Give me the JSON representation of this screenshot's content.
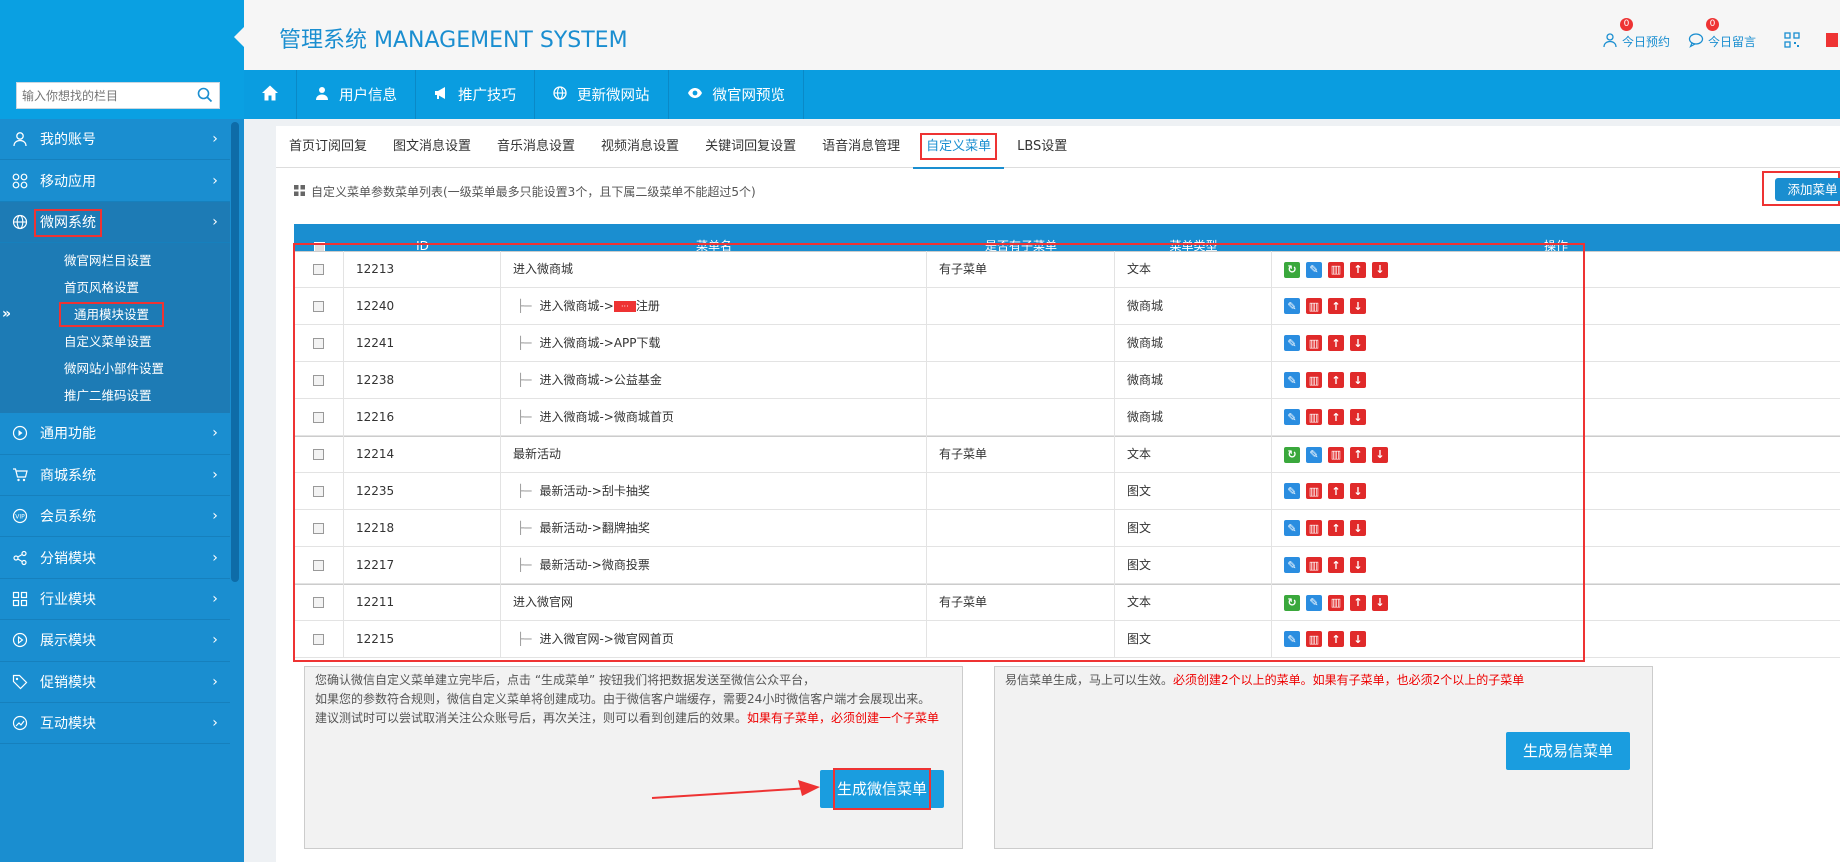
{
  "header": {
    "title": "管理系统 MANAGEMENT SYSTEM",
    "links": [
      {
        "label": "今日预约",
        "badge": "0",
        "icon": "user-icon"
      },
      {
        "label": "今日留言",
        "badge": "0",
        "icon": "chat-icon"
      }
    ]
  },
  "search": {
    "placeholder": "输入你想找的栏目"
  },
  "sidebar": {
    "items": [
      {
        "label": "我的账号",
        "icon": "user-icon"
      },
      {
        "label": "移动应用",
        "icon": "apps-icon"
      },
      {
        "label": "微网系统",
        "icon": "globe-icon",
        "active": true
      },
      {
        "label": "通用功能",
        "icon": "play-icon"
      },
      {
        "label": "商城系统",
        "icon": "cart-icon"
      },
      {
        "label": "会员系统",
        "icon": "vip-icon"
      },
      {
        "label": "分销模块",
        "icon": "share-icon"
      },
      {
        "label": "行业模块",
        "icon": "grid-icon"
      },
      {
        "label": "展示模块",
        "icon": "display-icon"
      },
      {
        "label": "促销模块",
        "icon": "tag-icon"
      },
      {
        "label": "互动模块",
        "icon": "chart-icon"
      }
    ],
    "submenu": [
      "微官网栏目设置",
      "首页风格设置",
      "通用模块设置",
      "自定义菜单设置",
      "微网站小部件设置",
      "推广二维码设置"
    ]
  },
  "navbar": {
    "items": [
      {
        "label": "用户信息",
        "icon": "user-icon"
      },
      {
        "label": "推广技巧",
        "icon": "megaphone-icon"
      },
      {
        "label": "更新微网站",
        "icon": "globe-icon"
      },
      {
        "label": "微官网预览",
        "icon": "eye-icon"
      }
    ]
  },
  "tabs": [
    "首页订阅回复",
    "图文消息设置",
    "音乐消息设置",
    "视频消息设置",
    "关键词回复设置",
    "语音消息管理",
    "自定义菜单",
    "LBS设置"
  ],
  "hint": "自定义菜单参数菜单列表(一级菜单最多只能设置3个，且下属二级菜单不能超过5个)",
  "add_button": "添加菜单",
  "table": {
    "headers": [
      "ID",
      "菜单名",
      "是否有子菜单",
      "菜单类型",
      "操作"
    ],
    "rows": [
      {
        "id": "12213",
        "name": "进入微商城",
        "child": false,
        "has_sub": "有子菜单",
        "type": "文本"
      },
      {
        "id": "12240",
        "name_prefix": "进入微商城->",
        "name": "注册",
        "redacted": true,
        "child": true,
        "has_sub": "",
        "type": "微商城"
      },
      {
        "id": "12241",
        "name": "进入微商城->APP下载",
        "child": true,
        "has_sub": "",
        "type": "微商城"
      },
      {
        "id": "12238",
        "name": "进入微商城->公益基金",
        "child": true,
        "has_sub": "",
        "type": "微商城"
      },
      {
        "id": "12216",
        "name": "进入微商城->微商城首页",
        "child": true,
        "has_sub": "",
        "type": "微商城"
      },
      {
        "id": "12214",
        "name": "最新活动",
        "child": false,
        "has_sub": "有子菜单",
        "type": "文本"
      },
      {
        "id": "12235",
        "name": "最新活动->刮卡抽奖",
        "child": true,
        "has_sub": "",
        "type": "图文"
      },
      {
        "id": "12218",
        "name": "最新活动->翻牌抽奖",
        "child": true,
        "has_sub": "",
        "type": "图文"
      },
      {
        "id": "12217",
        "name": "最新活动->微商投票",
        "child": true,
        "has_sub": "",
        "type": "图文"
      },
      {
        "id": "12211",
        "name": "进入微官网",
        "child": false,
        "has_sub": "有子菜单",
        "type": "文本"
      },
      {
        "id": "12215",
        "name": "进入微官网->微官网首页",
        "child": true,
        "has_sub": "",
        "type": "图文"
      }
    ]
  },
  "panel_left": {
    "line1": "您确认微信自定义菜单建立完毕后，点击 “生成菜单” 按钮我们将把数据发送至微信公众平台，",
    "line2": "如果您的参数符合规则，微信自定义菜单将创建成功。由于微信客户端缓存，需要24小时微信客户端才会展现出来。",
    "line3": "建议测试时可以尝试取消关注公众账号后，再次关注，则可以看到创建后的效果。",
    "line3_red": "如果有子菜单，必须创建一个子菜单",
    "button": "生成微信菜单"
  },
  "panel_right": {
    "text": "易信菜单生成，马上可以生效。",
    "text_red": "必须创建2个以上的菜单。如果有子菜单，也必须2个以上的子菜单",
    "button": "生成易信菜单"
  }
}
